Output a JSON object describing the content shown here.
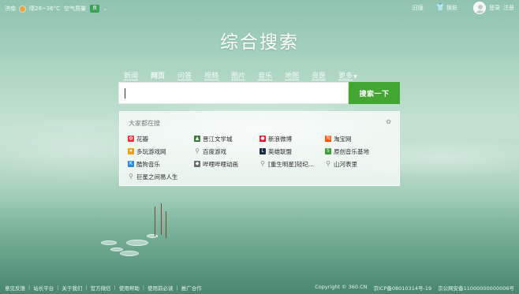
{
  "topbar": {
    "city": "济南",
    "weather": "晴28~36°C",
    "air_label": "空气质量",
    "air_value": "良",
    "old_version": "旧版",
    "skin": "换肤",
    "login": "登录",
    "register": "注册"
  },
  "logo": "综合搜索",
  "nav": {
    "tabs": [
      "新闻",
      "网页",
      "问答",
      "视频",
      "图片",
      "音乐",
      "地图",
      "良医",
      "更多"
    ]
  },
  "search": {
    "value": "",
    "button": "搜索一下"
  },
  "hot": {
    "title": "大家都在搜",
    "items": [
      {
        "label": "花瓣",
        "icon": "huaban-icon",
        "color": "#e0383e"
      },
      {
        "label": "晋江文学城",
        "icon": "jinjiang-icon",
        "color": "#3a7a3a"
      },
      {
        "label": "新浪微博",
        "icon": "weibo-icon",
        "color": "#e6162d"
      },
      {
        "label": "淘宝网",
        "icon": "taobao-icon",
        "color": "#ff5000"
      },
      {
        "label": "多玩游戏网",
        "icon": "duowan-icon",
        "color": "#f39c12"
      },
      {
        "label": "百度游戏",
        "icon": "search-icon",
        "color": "#8a8a8a"
      },
      {
        "label": "英雄联盟",
        "icon": "lol-icon",
        "color": "#1b2a44"
      },
      {
        "label": "原创音乐基地",
        "icon": "5sing-icon",
        "color": "#3aa03a"
      },
      {
        "label": "酷狗音乐",
        "icon": "kugou-icon",
        "color": "#2c8be0"
      },
      {
        "label": "哔哩哔哩动画",
        "icon": "bilibili-icon",
        "color": "#6b6b6b"
      },
      {
        "label": "[重生明星]轻纪...",
        "icon": "search-icon",
        "color": "#8a8a8a"
      },
      {
        "label": "山河表里",
        "icon": "search-icon",
        "color": "#8a8a8a"
      },
      {
        "label": "巨星之间易人生",
        "icon": "search-icon",
        "color": "#8a8a8a"
      }
    ]
  },
  "footer": {
    "links": [
      "意见反馈",
      "站长平台",
      "关于我们",
      "官方微信",
      "使用帮助",
      "使用前必读",
      "推广合作"
    ],
    "copyright": "Copyright © 360.CN",
    "icp": "京ICP备08010314号-19",
    "police": "京公网安备11000000000006号"
  },
  "colors": {
    "accent": "#43a633",
    "background": "#a9d4c0"
  }
}
